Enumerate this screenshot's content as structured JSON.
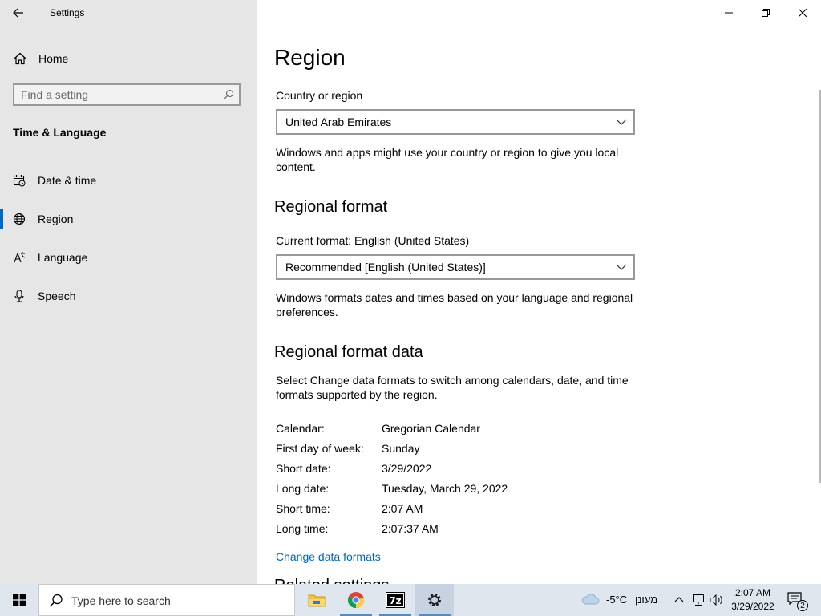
{
  "window": {
    "app_title": "Settings",
    "controls": [
      "minimize",
      "restore",
      "close"
    ]
  },
  "sidebar": {
    "home_label": "Home",
    "search_placeholder": "Find a setting",
    "section_title": "Time & Language",
    "items": [
      {
        "label": "Date & time",
        "icon": "date-time-icon",
        "selected": false
      },
      {
        "label": "Region",
        "icon": "globe-icon",
        "selected": true
      },
      {
        "label": "Language",
        "icon": "language-icon",
        "selected": false
      },
      {
        "label": "Speech",
        "icon": "microphone-icon",
        "selected": false
      }
    ]
  },
  "main": {
    "page_title": "Region",
    "country_label": "Country or region",
    "country_value": "United Arab Emirates",
    "country_desc": "Windows and apps might use your country or region to give you local content.",
    "regional_format_heading": "Regional format",
    "current_format_label": "Current format: English (United States)",
    "format_value": "Recommended [English (United States)]",
    "format_desc": "Windows formats dates and times based on your language and regional preferences.",
    "format_data_heading": "Regional format data",
    "format_data_desc": "Select Change data formats to switch among calendars, date, and time formats supported by the region.",
    "format_rows": [
      {
        "key": "Calendar:",
        "value": "Gregorian Calendar"
      },
      {
        "key": "First day of week:",
        "value": "Sunday"
      },
      {
        "key": "Short date:",
        "value": "3/29/2022"
      },
      {
        "key": "Long date:",
        "value": "Tuesday, March 29, 2022"
      },
      {
        "key": "Short time:",
        "value": "2:07 AM"
      },
      {
        "key": "Long time:",
        "value": "2:07:37 AM"
      }
    ],
    "change_link": "Change data formats",
    "related_heading_partial": "Related settings"
  },
  "taskbar": {
    "search_text": "Type here to search",
    "apps": [
      "file-explorer-icon",
      "chrome-icon",
      "7zip-icon",
      "settings-icon"
    ],
    "weather_temp": "-5°C",
    "weather_desc": "מעונן",
    "clock_time": "2:07 AM",
    "clock_date": "3/29/2022",
    "notification_count": "2",
    "accent": "#0067c0"
  }
}
